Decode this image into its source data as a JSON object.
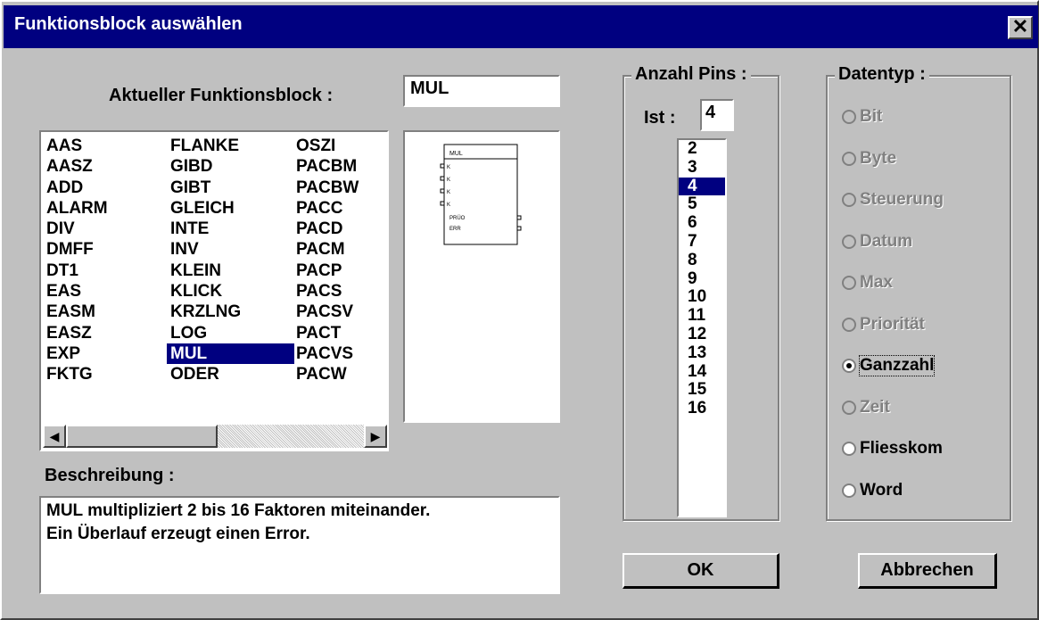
{
  "window": {
    "title": "Funktionsblock auswählen",
    "close_label": "✕"
  },
  "current_block": {
    "label": "Aktueller Funktionsblock :",
    "value": "MUL"
  },
  "function_list": {
    "col1": [
      "AAS",
      "AASZ",
      "ADD",
      "ALARM",
      "DIV",
      "DMFF",
      "DT1",
      "EAS",
      "EASM",
      "EASZ",
      "EXP",
      "FKTG"
    ],
    "col2": [
      "FLANKE",
      "GIBD",
      "GIBT",
      "GLEICH",
      "INTE",
      "INV",
      "KLEIN",
      "KLICK",
      "KRZLNG",
      "LOG",
      "MUL",
      "ODER"
    ],
    "col3": [
      "OSZI",
      "PACBM",
      "PACBW",
      "PACC",
      "PACD",
      "PACM",
      "PACP",
      "PACS",
      "PACSV",
      "PACT",
      "PACVS",
      "PACW"
    ],
    "selected": "MUL"
  },
  "preview": {
    "block_name": "MUL",
    "inputs": [
      "K",
      "K",
      "K",
      "K"
    ],
    "outputs": [
      "PRÜO",
      "ERR"
    ]
  },
  "description": {
    "label": "Beschreibung :",
    "line1": "MUL multipliziert 2 bis 16 Faktoren miteinander.",
    "line2": "Ein Überlauf erzeugt einen Error."
  },
  "pins": {
    "title": "Anzahl Pins :",
    "ist_label": "Ist :",
    "ist_value": "4",
    "options": [
      "2",
      "3",
      "4",
      "5",
      "6",
      "7",
      "8",
      "9",
      "10",
      "11",
      "12",
      "13",
      "14",
      "15",
      "16"
    ],
    "selected": "4"
  },
  "datatype": {
    "title": "Datentyp :",
    "options": [
      {
        "label": "Bit",
        "enabled": false,
        "checked": false
      },
      {
        "label": "Byte",
        "enabled": false,
        "checked": false
      },
      {
        "label": "Steuerung",
        "enabled": false,
        "checked": false
      },
      {
        "label": "Datum",
        "enabled": false,
        "checked": false
      },
      {
        "label": "Max",
        "enabled": false,
        "checked": false
      },
      {
        "label": "Priorität",
        "enabled": false,
        "checked": false
      },
      {
        "label": "Ganzzahl",
        "enabled": true,
        "checked": true
      },
      {
        "label": "Zeit",
        "enabled": false,
        "checked": false
      },
      {
        "label": "Fliesskom",
        "enabled": true,
        "checked": false
      },
      {
        "label": "Word",
        "enabled": true,
        "checked": false
      }
    ]
  },
  "buttons": {
    "ok": "OK",
    "cancel": "Abbrechen"
  }
}
